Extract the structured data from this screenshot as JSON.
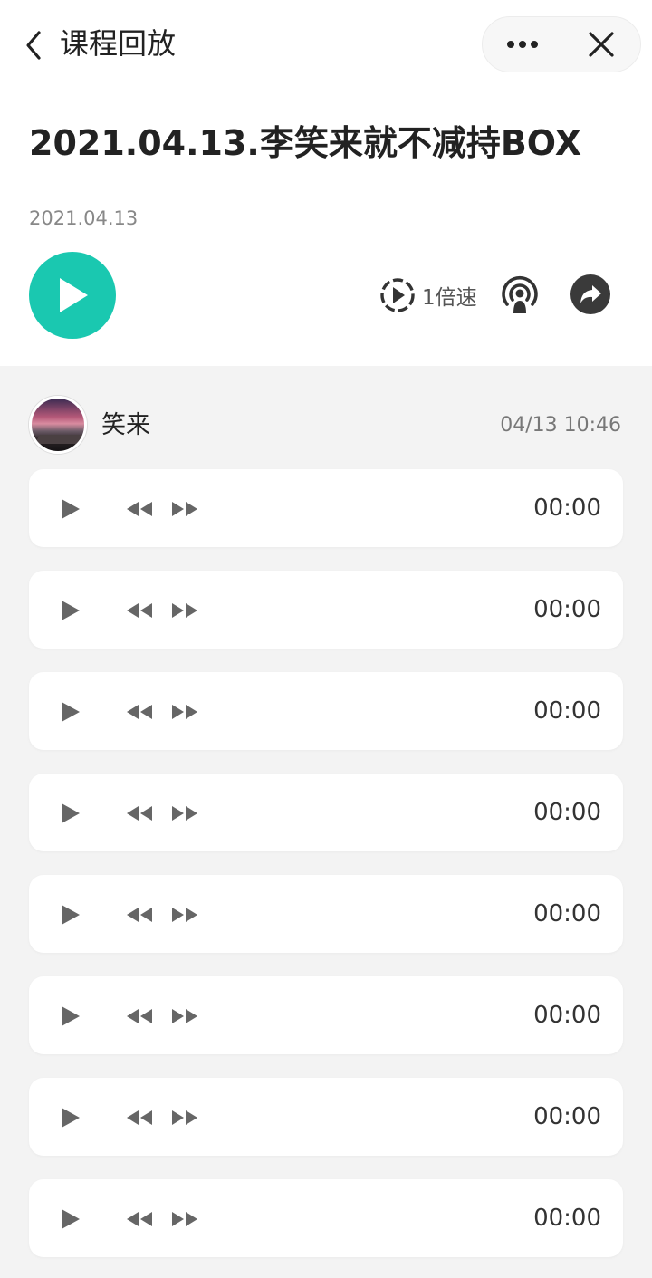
{
  "nav": {
    "title": "课程回放",
    "back_icon": "back-chevron-icon",
    "more_icon": "more-dots-icon",
    "close_icon": "close-icon"
  },
  "lesson": {
    "title": "2021.04.13.李笑来就不减持BOX",
    "date": "2021.04.13"
  },
  "controls": {
    "play_icon": "play-icon",
    "speed_label": "1倍速",
    "podcast_icon": "podcast-icon",
    "share_icon": "share-arrow-icon",
    "accent_color": "#1ac8b0"
  },
  "post": {
    "author": "笑来",
    "time": "04/13 10:46"
  },
  "audio_clips": [
    {
      "duration": "00:00"
    },
    {
      "duration": "00:00"
    },
    {
      "duration": "00:00"
    },
    {
      "duration": "00:00"
    },
    {
      "duration": "00:00"
    },
    {
      "duration": "00:00"
    },
    {
      "duration": "00:00"
    },
    {
      "duration": "00:00"
    }
  ]
}
